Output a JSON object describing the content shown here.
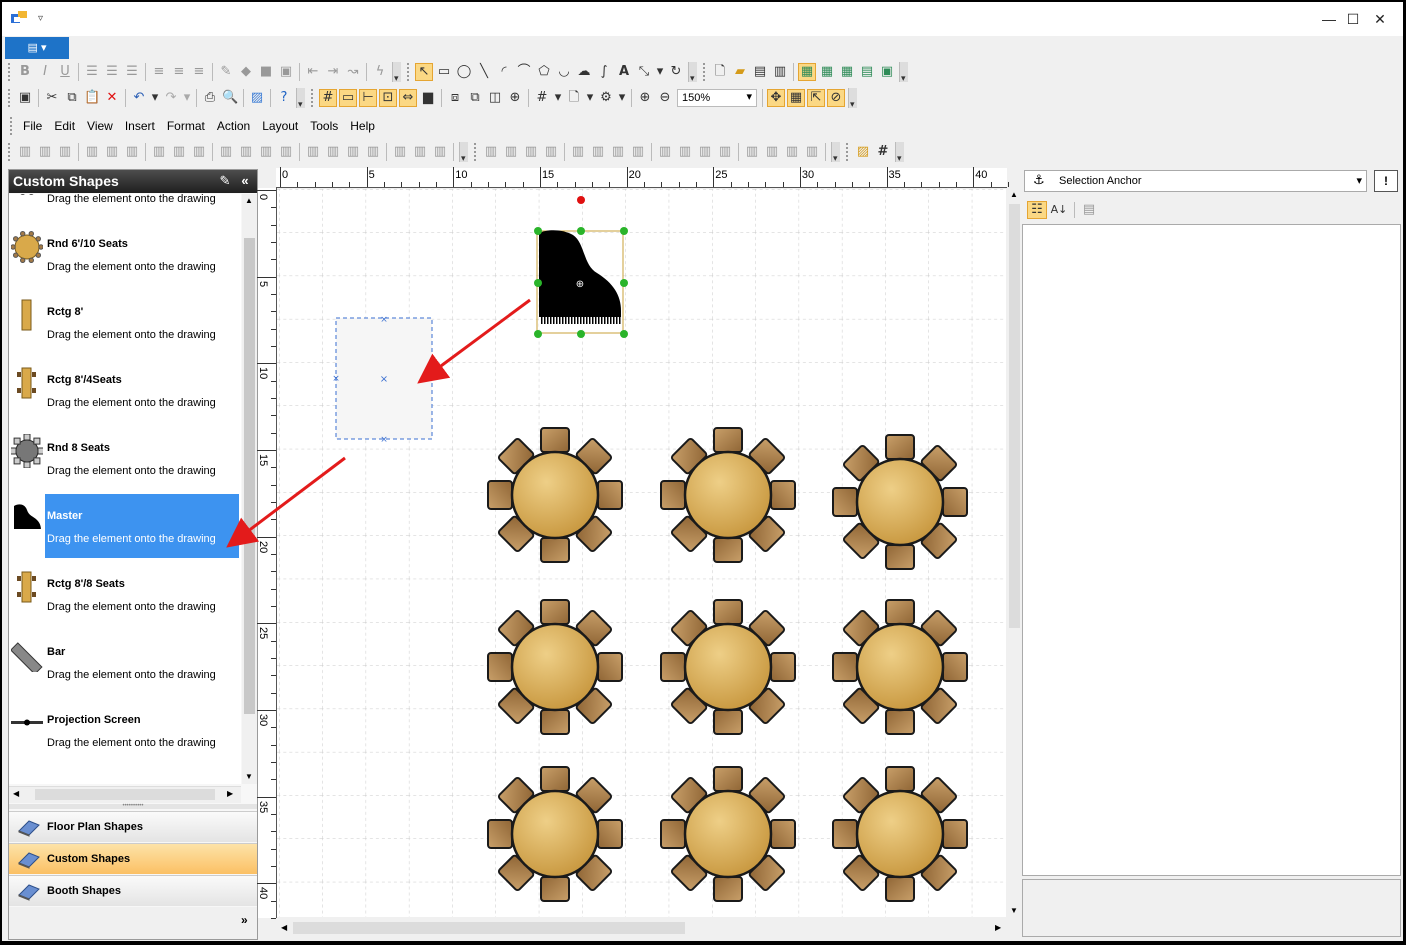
{
  "menu": {
    "items": [
      "File",
      "Edit",
      "View",
      "Insert",
      "Format",
      "Action",
      "Layout",
      "Tools",
      "Help"
    ]
  },
  "toolbar": {
    "zoom_value": "150%",
    "format_bold": "B",
    "format_italic": "I",
    "format_underline": "U",
    "text_tool": "A",
    "grid_tool": "#"
  },
  "left_panel": {
    "title": "Custom Shapes",
    "shapes": [
      {
        "name": "",
        "description": "Drag the element onto the drawing",
        "icon": "round-table-icon"
      },
      {
        "name": "Rnd 6'/10 Seats",
        "description": "Drag the element onto the drawing",
        "icon": "round-table-icon"
      },
      {
        "name": "Rctg 8'",
        "description": "Drag the element onto the drawing",
        "icon": "rectangle-table-icon"
      },
      {
        "name": "Rctg 8'/4Seats",
        "description": "Drag the element onto the drawing",
        "icon": "rectangle-table-seats-icon"
      },
      {
        "name": "Rnd 8 Seats",
        "description": "Drag the element onto the drawing",
        "icon": "round-table-gray-icon"
      },
      {
        "name": "Master",
        "description": "Drag the element onto the drawing",
        "icon": "piano-icon",
        "selected": true
      },
      {
        "name": "Rctg 8'/8 Seats",
        "description": "Drag the element onto the drawing",
        "icon": "rectangle-table-seats-icon"
      },
      {
        "name": "Bar",
        "description": "Drag the element onto the drawing",
        "icon": "bar-icon"
      },
      {
        "name": "Projection Screen",
        "description": "Drag the element onto the drawing",
        "icon": "projection-screen-icon"
      }
    ],
    "nav": [
      {
        "label": "Floor Plan Shapes",
        "active": false
      },
      {
        "label": "Custom Shapes",
        "active": true
      },
      {
        "label": "Booth Shapes",
        "active": false
      }
    ]
  },
  "ruler": {
    "top_labels": [
      "0",
      "5",
      "10",
      "15",
      "20",
      "25",
      "30",
      "35",
      "40"
    ],
    "left_labels": [
      "0",
      "5",
      "10",
      "15",
      "20",
      "25",
      "30",
      "35",
      "40"
    ]
  },
  "properties": {
    "selected_object": "Selection Anchor",
    "pin_label": "!"
  },
  "colors": {
    "accent": "#3d93f0",
    "table_fill": "#d9a94a",
    "chair_fill": "#b58a55",
    "arrow": "#e31b1b",
    "selection_handle": "#2ab42a",
    "rotate_handle": "#e01010"
  }
}
